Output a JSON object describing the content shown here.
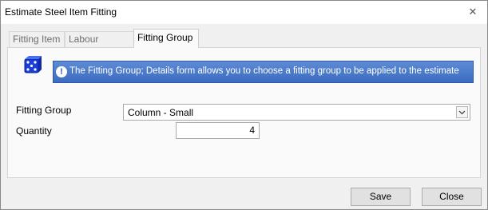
{
  "window": {
    "title": "Estimate Steel Item Fitting",
    "close_glyph": "✕"
  },
  "tabs": [
    {
      "label": "Fitting Item",
      "active": false
    },
    {
      "label": "Labour Process",
      "active": false
    },
    {
      "label": "Fitting Group",
      "active": true
    }
  ],
  "info": {
    "icon": "info-icon",
    "text": "The Fitting Group; Details form allows you to choose a fitting group to be applied to the estimate"
  },
  "form": {
    "fitting_group_label": "Fitting Group",
    "fitting_group_value": "Column - Small",
    "quantity_label": "Quantity",
    "quantity_value": "4"
  },
  "buttons": {
    "save": "Save",
    "close": "Close"
  },
  "colors": {
    "accent": "#3b6cc2",
    "app_icon": "#1b3fd6"
  }
}
